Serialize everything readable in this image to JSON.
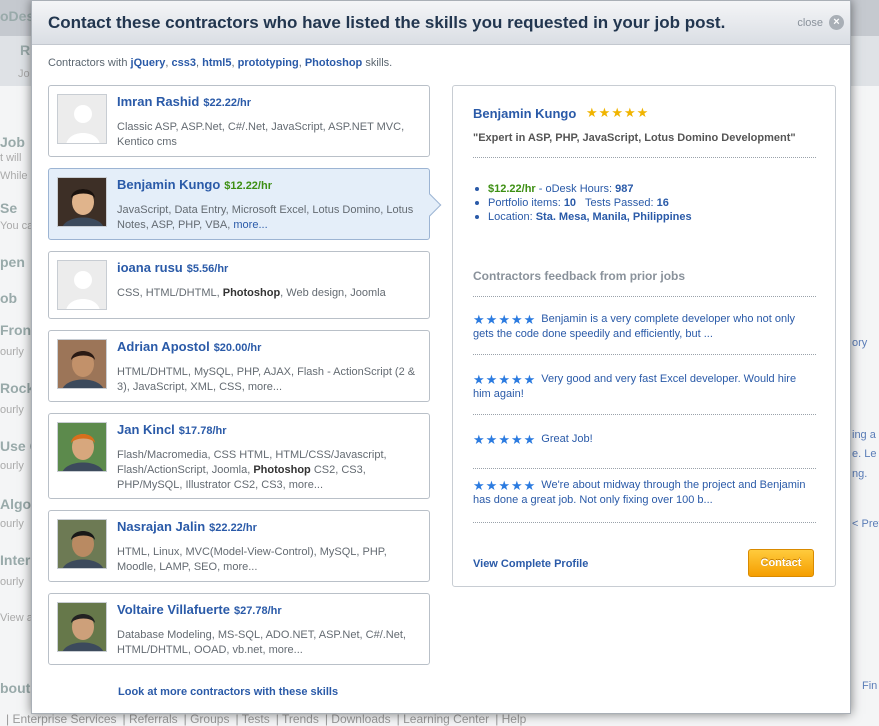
{
  "background": {
    "top_fragment": "oDes",
    "tab_fragments": [
      "R",
      "Jo"
    ],
    "left_fragments": [
      {
        "text": "Job",
        "big": true
      },
      {
        "text": "t will",
        "big": false
      },
      {
        "text": "While",
        "big": false
      },
      {
        "text": "Se",
        "big": true
      },
      {
        "text": "You ca",
        "big": false
      },
      {
        "text": "pen",
        "big": true
      },
      {
        "text": "ob",
        "big": true
      },
      {
        "text": "Front",
        "big": true
      },
      {
        "text": "ourly",
        "big": false
      },
      {
        "text": "Rocks",
        "big": true
      },
      {
        "text": "ourly",
        "big": false
      },
      {
        "text": "Use G",
        "big": true
      },
      {
        "text": "ourly",
        "big": false
      },
      {
        "text": "Algori",
        "big": true
      },
      {
        "text": "ourly",
        "big": false
      },
      {
        "text": "Inter",
        "big": true
      },
      {
        "text": "ourly",
        "big": false
      },
      {
        "text": "View a",
        "big": false
      },
      {
        "text": "bout",
        "big": true
      }
    ],
    "right_fragments": [
      "ory",
      "ing a",
      "e. Le",
      "ng.",
      "< Prev",
      "Fin"
    ],
    "footer_links": [
      "Enterprise Services",
      "Referrals",
      "Groups",
      "Tests",
      "Trends",
      "Downloads",
      "Learning Center",
      "Help"
    ]
  },
  "modal": {
    "title": "Contact these contractors who have listed the skills you requested in your job post.",
    "close_label": "close",
    "subtitle_prefix": "Contractors with ",
    "subtitle_skills": [
      "jQuery",
      "css3",
      "html5",
      "prototyping",
      "Photoshop"
    ],
    "subtitle_suffix": " skills.",
    "more_link": "Look at more contractors with these skills"
  },
  "contractors": [
    {
      "name": "Imran Rashid",
      "rate": "$22.22/hr",
      "skills_html": "Classic ASP, ASP.Net, C#/.Net, JavaScript, ASP.NET MVC, Kentico cms",
      "avatar": "placeholder"
    },
    {
      "name": "Benjamin Kungo",
      "rate": "$12.22/hr",
      "skills_html": "JavaScript, Data Entry, Microsoft Excel, Lotus Domino, Lotus Notes, ASP, PHP, VBA, <span class='more'>more...</span>",
      "avatar": "photo",
      "selected": true
    },
    {
      "name": "ioana rusu",
      "rate": "$5.56/hr",
      "skills_html": "CSS, HTML/DHTML, <b>Photoshop</b>, Web design, Joomla",
      "avatar": "placeholder"
    },
    {
      "name": "Adrian Apostol",
      "rate": "$20.00/hr",
      "skills_html": "HTML/DHTML, MySQL, PHP, AJAX, Flash - ActionScript (2 & 3), JavaScript, XML, CSS, more...",
      "avatar": "photo"
    },
    {
      "name": "Jan Kincl",
      "rate": "$17.78/hr",
      "skills_html": "Flash/Macromedia, CSS HTML, HTML/CSS/Javascript, Flash/ActionScript, Joomla, <b>Photoshop</b> CS2, CS3, PHP/MySQL, Illustrator CS2, CS3, more...",
      "avatar": "photo"
    },
    {
      "name": "Nasrajan Jalin",
      "rate": "$22.22/hr",
      "skills_html": "HTML, Linux, MVC(Model-View-Control), MySQL, PHP, Moodle, LAMP, SEO, more...",
      "avatar": "photo"
    },
    {
      "name": "Voltaire Villafuerte",
      "rate": "$27.78/hr",
      "skills_html": "Database Modeling, MS-SQL, ADO.NET, ASP.Net, C#/.Net, HTML/DHTML, OOAD, vb.net, more...",
      "avatar": "photo"
    }
  ],
  "detail": {
    "name": "Benjamin Kungo",
    "rating_stars": 5,
    "tagline": "\"Expert in ASP, PHP, JavaScript, Lotus Domino Development\"",
    "rate": "$12.22/hr",
    "odesk_hours_label": " - oDesk Hours: ",
    "odesk_hours": "987",
    "portfolio_label": "Portfolio items: ",
    "portfolio": "10",
    "tests_label": "Tests Passed: ",
    "tests": "16",
    "location_label": "Location: ",
    "location": "Sta. Mesa, Manila, Philippines",
    "feedback_heading": "Contractors feedback from prior jobs",
    "feedback": [
      {
        "stars": 5,
        "text": "Benjamin is a very complete developer who not only gets the code done speedily and efficiently, but ..."
      },
      {
        "stars": 5,
        "text": "Very good and very fast Excel developer. Would hire him again!"
      },
      {
        "stars": 5,
        "text": "Great Job!"
      },
      {
        "stars": 5,
        "text": "We're about midway through the project and Benjamin has done a great job. Not only fixing over 100 b..."
      }
    ],
    "view_profile": "View Complete Profile",
    "contact_label": "Contact"
  },
  "colors": {
    "link": "#2a5aa8",
    "rate_green": "#3d8f13",
    "star_gold": "#f0b400",
    "star_blue": "#2b7be0",
    "button": "#f5a300"
  }
}
